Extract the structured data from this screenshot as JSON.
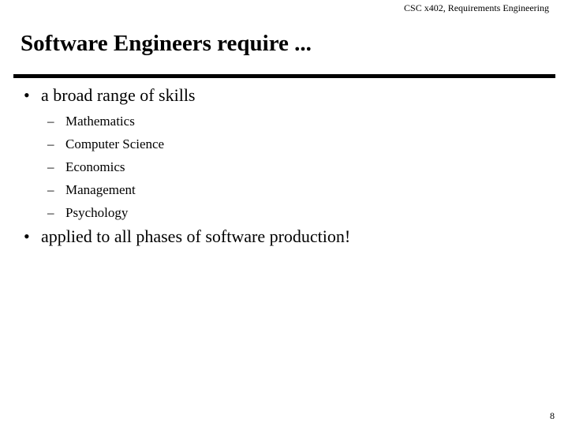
{
  "header": {
    "course": "CSC x402, Requirements  Engineering"
  },
  "slide": {
    "title": "Software Engineers require ...",
    "bullets": [
      {
        "marker": "•",
        "text": "a broad range of skills",
        "subitems": [
          {
            "marker": "–",
            "text": "Mathematics"
          },
          {
            "marker": "–",
            "text": "Computer Science"
          },
          {
            "marker": "–",
            "text": "Economics"
          },
          {
            "marker": "–",
            "text": "Management"
          },
          {
            "marker": "–",
            "text": "Psychology"
          }
        ]
      },
      {
        "marker": "•",
        "text": "applied to all phases of software production!"
      }
    ]
  },
  "footer": {
    "page_number": "8"
  }
}
